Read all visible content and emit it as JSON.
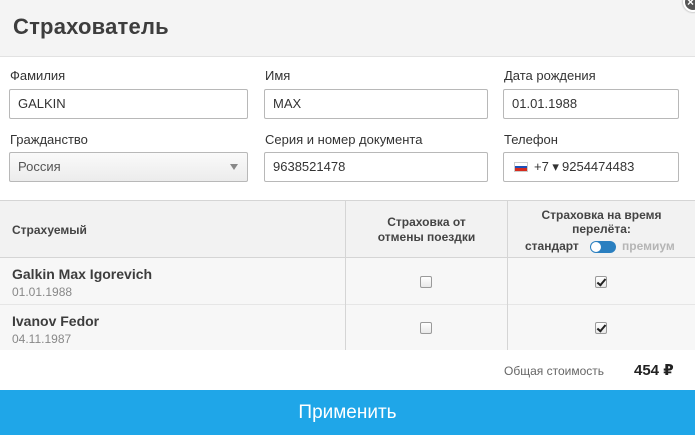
{
  "dialog": {
    "title": "Страхователь",
    "close_glyph": "×"
  },
  "form": {
    "last_name": {
      "label": "Фамилия",
      "value": "GALKIN"
    },
    "first_name": {
      "label": "Имя",
      "value": "MAX"
    },
    "birth_date": {
      "label": "Дата рождения",
      "value": "01.01.1988"
    },
    "citizenship": {
      "label": "Гражданство",
      "value": "Россия"
    },
    "document": {
      "label": "Серия и номер документа",
      "value": "9638521478"
    },
    "phone": {
      "label": "Телефон",
      "code": "+7 ▾",
      "value": "9254474483"
    }
  },
  "table": {
    "headers": {
      "insured": "Страхуемый",
      "cancellation_line1": "Страховка от",
      "cancellation_line2": "отмены поездки",
      "flight_line1": "Страховка на время",
      "flight_line2": "перелёта:",
      "toggle_left": "стандарт",
      "toggle_right": "премиум"
    },
    "rows": [
      {
        "name": "Galkin Max Igorevich",
        "date": "01.01.1988",
        "cancellation": false,
        "flight": true
      },
      {
        "name": "Ivanov Fedor",
        "date": "04.11.1987",
        "cancellation": false,
        "flight": true
      }
    ]
  },
  "total": {
    "label": "Общая стоимость",
    "value": "454 ₽"
  },
  "apply_label": "Применить",
  "colors": {
    "accent": "#1fa6e8",
    "toggle": "#2a7fc0",
    "header_bg": "#f4f4f4"
  }
}
